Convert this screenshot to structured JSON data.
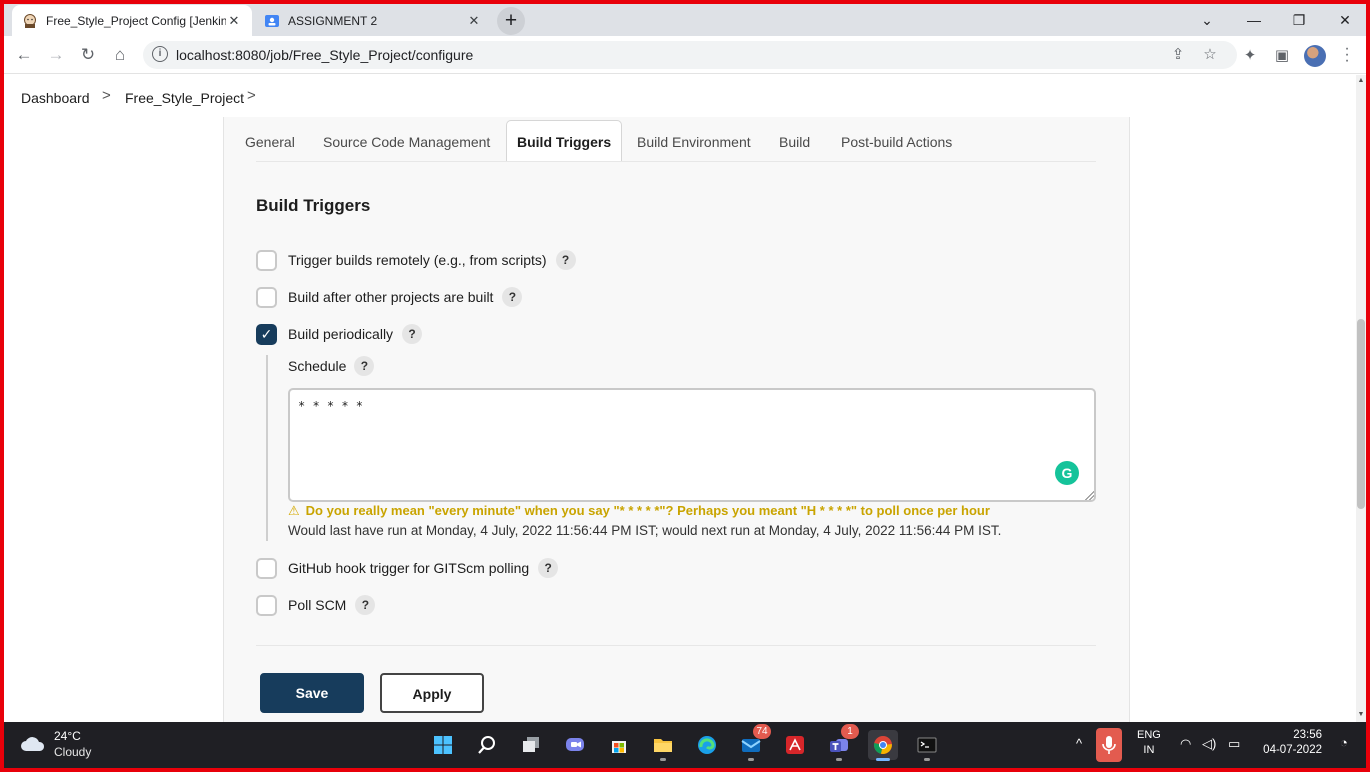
{
  "browser": {
    "tabs": [
      {
        "title": "Free_Style_Project Config [Jenkins]",
        "close": "✕"
      },
      {
        "title": "ASSIGNMENT 2",
        "close": "✕"
      }
    ],
    "new_tab": "+",
    "window_controls": {
      "minimize": "—",
      "maximize": "❐",
      "close": "✕"
    },
    "nav": {
      "back": "←",
      "forward": "→",
      "reload": "↻",
      "home": "⌂"
    },
    "address": "localhost:8080/job/Free_Style_Project/configure",
    "icons": [
      "info-icon",
      "share-icon",
      "star-icon",
      "extensions-icon",
      "side-panel-icon",
      "profile-avatar",
      "menu-icon"
    ]
  },
  "breadcrumb": {
    "items": [
      "Dashboard",
      "Free_Style_Project"
    ],
    "separator": ">"
  },
  "config": {
    "tabs": [
      "General",
      "Source Code Management",
      "Build Triggers",
      "Build Environment",
      "Build",
      "Post-build Actions"
    ],
    "active_tab": "Build Triggers",
    "section_title": "Build Triggers",
    "help_glyph": "?",
    "options": [
      {
        "label": "Trigger builds remotely (e.g., from scripts)",
        "checked": false
      },
      {
        "label": "Build after other projects are built",
        "checked": false
      },
      {
        "label": "Build periodically",
        "checked": true
      },
      {
        "label": "GitHub hook trigger for GITScm polling",
        "checked": false
      },
      {
        "label": "Poll SCM",
        "checked": false
      }
    ],
    "checkmark": "✓",
    "schedule": {
      "label": "Schedule",
      "value": "* * * * *",
      "warning_icon": "⚠",
      "warning": "Do you really mean \"every minute\" when you say \"* * * * *\"? Perhaps you meant \"H * * * *\" to poll once per hour",
      "next_run": "Would last have run at Monday, 4 July, 2022 11:56:44 PM IST; would next run at Monday, 4 July, 2022 11:56:44 PM IST."
    },
    "grammarly": "G",
    "buttons": {
      "save": "Save",
      "apply": "Apply"
    }
  },
  "taskbar": {
    "weather": {
      "temp": "24°C",
      "desc": "Cloudy"
    },
    "apps": [
      {
        "name": "start-icon"
      },
      {
        "name": "search-icon"
      },
      {
        "name": "task-view-icon"
      },
      {
        "name": "chat-icon"
      },
      {
        "name": "store-icon"
      },
      {
        "name": "file-explorer-icon"
      },
      {
        "name": "edge-icon"
      },
      {
        "name": "mail-icon",
        "badge": "74"
      },
      {
        "name": "acrobat-icon"
      },
      {
        "name": "teams-icon",
        "badge": "1"
      },
      {
        "name": "chrome-icon"
      },
      {
        "name": "terminal-icon"
      }
    ],
    "tray": {
      "chevron": "^",
      "lang1": "ENG",
      "lang2": "IN",
      "time": "23:56",
      "date": "04-07-2022"
    }
  },
  "colors": {
    "jenkins_primary": "#173c5c",
    "warning": "#c9a400",
    "frame_border": "#e8000a",
    "grammarly": "#15c39a"
  }
}
